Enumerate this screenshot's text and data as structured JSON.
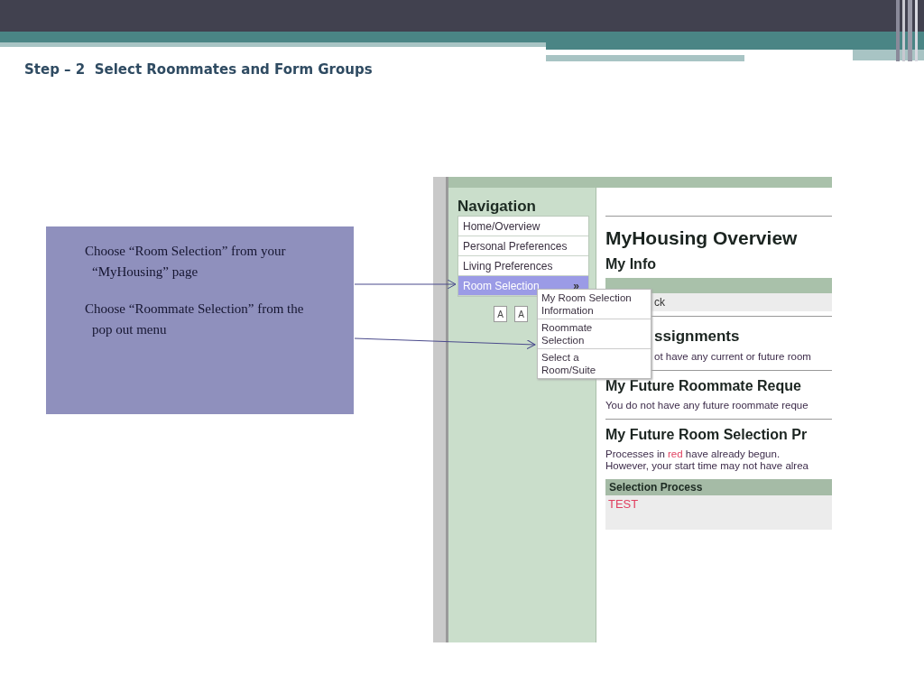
{
  "slide": {
    "title": "Step – 2  Select Roommates and Form Groups"
  },
  "instructions": [
    "Choose “Room Selection” from your “MyHousing” page",
    "Choose “Roommate Selection” from the pop out menu"
  ],
  "screenshot": {
    "navigation": {
      "heading": "Navigation",
      "items": [
        {
          "label": "Home/Overview",
          "selected": false
        },
        {
          "label": "Personal Preferences",
          "selected": false
        },
        {
          "label": "Living Preferences",
          "selected": false
        },
        {
          "label": "Room Selection",
          "selected": true,
          "submenu_marker": "»"
        }
      ]
    },
    "text_size_buttons": [
      "A",
      "A"
    ],
    "popup_menu": [
      "My Room Selection Information",
      "Roommate Selection",
      "Select a Room/Suite"
    ],
    "content": {
      "title": "MyHousing Overview",
      "my_info": {
        "heading": "My Info",
        "row": "ck"
      },
      "assignments": {
        "heading": "ssignments",
        "text": "ot have any current or future room"
      },
      "roommate_requests": {
        "heading": "My Future Roommate Reque",
        "text": "You do not have any future roommate reque"
      },
      "room_selection": {
        "heading": "My Future Room Selection Pr",
        "note": [
          {
            "text": "Processes in ",
            "highlight": false
          },
          {
            "text": "red",
            "highlight": true
          },
          {
            "text": " have already begun.",
            "highlight": false
          }
        ],
        "note_2": "However, your start time may not have alrea",
        "table": {
          "columns": [
            "Selection Process"
          ],
          "rows": [
            {
              "cells": [
                "TEST"
              ],
              "begun": true
            }
          ]
        }
      }
    }
  }
}
